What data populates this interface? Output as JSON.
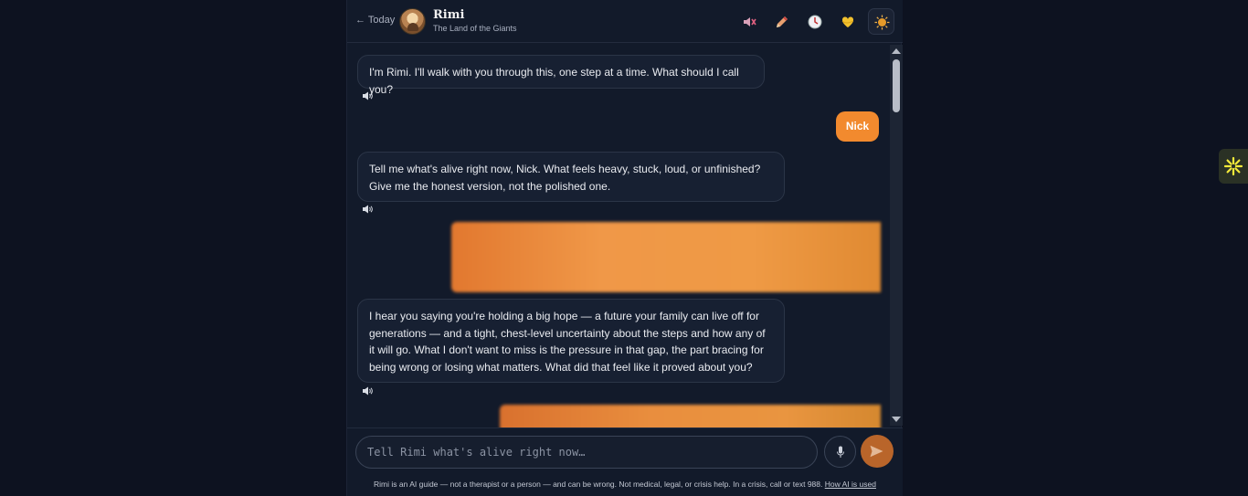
{
  "header": {
    "back_label": "← Today",
    "title": "Rimi",
    "subtitle": "The Land of the Giants",
    "icons": [
      "mute-icon",
      "pencil-icon",
      "clock-icon",
      "heart-icon",
      "sun-icon"
    ]
  },
  "messages": [
    {
      "role": "assistant",
      "text": "I'm Rimi. I'll walk with you through this, one step at a time. What should I call you?"
    },
    {
      "role": "user",
      "text": "Nick"
    },
    {
      "role": "assistant",
      "text": "Tell me what's alive right now, Nick. What feels heavy, stuck, loud, or unfinished? Give me the honest version, not the polished one."
    },
    {
      "role": "user",
      "text": "",
      "redacted": true
    },
    {
      "role": "assistant",
      "text": "I hear you saying you're holding a big hope — a future your family can live off for generations — and a tight, chest-level uncertainty about the steps and how any of it will go. What I don't want to miss is the pressure in that gap, the part bracing for being wrong or losing what matters. What did that feel like it proved about you?"
    },
    {
      "role": "user",
      "text": "",
      "redacted": true
    }
  ],
  "composer": {
    "placeholder": "Tell Rimi what's alive right now…",
    "value": ""
  },
  "footer": {
    "disclaimer": "Rimi is an AI guide — not a therapist or a person — and can be wrong. Not medical, legal, or crisis help. In a crisis, call or text 988.",
    "link_label": "How AI is used"
  },
  "colors": {
    "accent": "#f28a2e",
    "background": "#0d1220",
    "panel": "#121a2a",
    "assistant_bubble": "#172032"
  }
}
